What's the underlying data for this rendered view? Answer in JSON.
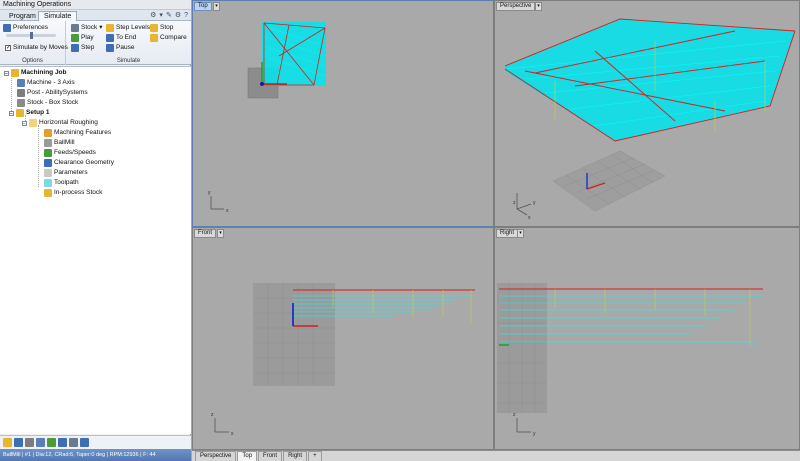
{
  "panel": {
    "title": "Machining Operations",
    "tabs": [
      "Program",
      "Simulate"
    ],
    "ribbon": {
      "options": {
        "preferences": "Preferences",
        "simulate_by_moves": "Simulate by Moves",
        "label": "Options"
      },
      "simulate": {
        "stock": "Stock",
        "play": "Play",
        "step": "Step",
        "step_levels": "Step Levels",
        "to_end": "To End",
        "pause": "Pause",
        "stop": "Stop",
        "compare": "Compare",
        "label": "Simulate"
      }
    },
    "tree": {
      "root": "Machining Job",
      "machine": "Machine - 3 Axis",
      "post": "Post - AbilitySystems",
      "stock": "Stock - Box Stock",
      "setup": "Setup 1",
      "operation": "Horizontal Roughing",
      "children": [
        "Machining Features",
        "BallMill",
        "Feeds/Speeds",
        "Clearance Geometry",
        "Parameters",
        "Toolpath",
        "In-process Stock"
      ]
    },
    "status": "BallMill | #1 | Dia:12, CRad:6, Taper:0 deg | RPM:12936 | F: 44"
  },
  "viewports": {
    "top": "Top",
    "perspective": "Perspective",
    "front": "Front",
    "right": "Right"
  },
  "viewport_tabs": [
    "Perspective",
    "Top",
    "Front",
    "Right"
  ],
  "add_tab_symbol": "+",
  "colors": {
    "toolpath": "#00ffff",
    "rapid": "#e52020",
    "selection_blue": "#5f7fb0",
    "status_bar": "#4f78b5"
  }
}
